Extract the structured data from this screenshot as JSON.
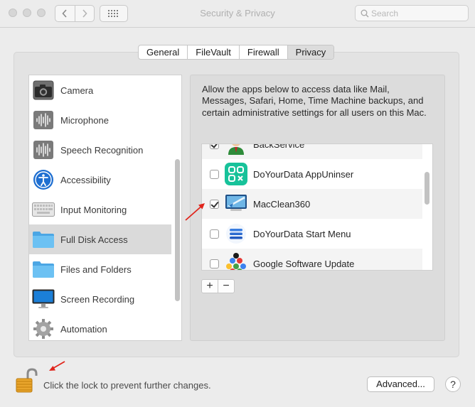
{
  "window": {
    "title": "Security & Privacy",
    "search_placeholder": "Search"
  },
  "tabs": [
    {
      "label": "General",
      "selected": false
    },
    {
      "label": "FileVault",
      "selected": false
    },
    {
      "label": "Firewall",
      "selected": false
    },
    {
      "label": "Privacy",
      "selected": true
    }
  ],
  "sidebar": {
    "items": [
      {
        "label": "Camera",
        "icon": "camera-icon"
      },
      {
        "label": "Microphone",
        "icon": "microphone-icon"
      },
      {
        "label": "Speech Recognition",
        "icon": "speech-recognition-icon"
      },
      {
        "label": "Accessibility",
        "icon": "accessibility-icon"
      },
      {
        "label": "Input Monitoring",
        "icon": "keyboard-icon"
      },
      {
        "label": "Full Disk Access",
        "icon": "folder-icon",
        "selected": true
      },
      {
        "label": "Files and Folders",
        "icon": "folder-icon"
      },
      {
        "label": "Screen Recording",
        "icon": "display-icon"
      },
      {
        "label": "Automation",
        "icon": "gear-icon"
      }
    ]
  },
  "main": {
    "description": "Allow the apps below to access data like Mail, Messages, Safari, Home, Time Machine backups, and certain administrative settings for all users on this Mac.",
    "apps": [
      {
        "label": "BackService",
        "checked": true,
        "icon": "backservice-icon"
      },
      {
        "label": "DoYourData AppUninser",
        "checked": false,
        "icon": "doyourdata-appuninser-icon"
      },
      {
        "label": "MacClean360",
        "checked": true,
        "icon": "macclean360-icon"
      },
      {
        "label": "DoYourData Start Menu",
        "checked": false,
        "icon": "doyourdata-start-menu-icon"
      },
      {
        "label": "Google Software Update",
        "checked": false,
        "icon": "google-software-update-icon"
      }
    ],
    "add_label": "+",
    "remove_label": "−"
  },
  "footer": {
    "lock_text": "Click the lock to prevent further changes.",
    "advanced_label": "Advanced...",
    "help_label": "?"
  },
  "colors": {
    "window_bg": "#ececec",
    "folder_blue": "#5ab4ee",
    "annotation_red": "#e0241b",
    "lock_gold": "#e9a52c"
  }
}
